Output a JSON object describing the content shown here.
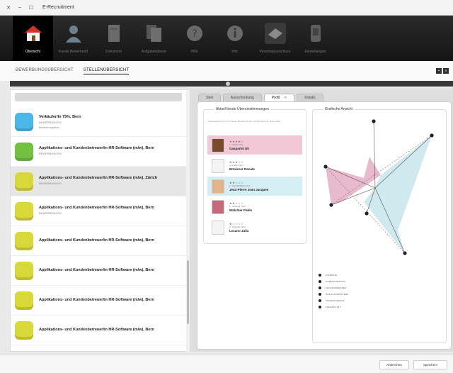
{
  "window": {
    "title": "E-Recruitment",
    "controls": [
      "✕",
      "–",
      "☐"
    ]
  },
  "toolbar": {
    "items": [
      {
        "label": "Übersicht",
        "icon": "house-icon",
        "active": true
      },
      {
        "label": "Kunde Bewerberid",
        "icon": "person-icon",
        "active": false
      },
      {
        "label": "Dokument",
        "icon": "document-icon",
        "active": false
      },
      {
        "label": "Aufgabenplaner",
        "icon": "documents-icon",
        "active": false
      },
      {
        "label": "Hilfe",
        "icon": "help-icon",
        "active": false
      },
      {
        "label": "Info",
        "icon": "info-icon",
        "active": false
      },
      {
        "label": "Personalausschuss",
        "icon": "group-icon",
        "active": false
      },
      {
        "label": "Einstellungen",
        "icon": "phone-icon",
        "active": false
      }
    ]
  },
  "subnav": {
    "tabs": [
      "BEWERBUNGSÜBERSICHT",
      "STELLENÜBERSICHT"
    ],
    "active_index": 1
  },
  "list": {
    "items": [
      {
        "title": "Verkäufer/In 75%, Bern",
        "sub1": "BEWERBUNGEN",
        "sub2": "Bewerbungsfrist",
        "color": "#4bb6e8"
      },
      {
        "title": "Applikations- und Kundenbetreuer/in HR-Software (m/w), Bern",
        "sub1": "BEWERBUNGEN",
        "sub2": "",
        "color": "#74c043"
      },
      {
        "title": "Applikations- und Kundenbetreuer/in HR-Software (m/w), Zürich",
        "sub1": "BEWERBUNGEN",
        "sub2": "",
        "color": "#d9d83a"
      },
      {
        "title": "Applikations- und Kundenbetreuer/in HR-Software (m/w), Bern",
        "sub1": "BEWERBUNGEN",
        "sub2": "",
        "color": "#d9d83a"
      },
      {
        "title": "Applikations- und Kundenbetreuer/in HR-Software (m/w), Bern",
        "sub1": "",
        "sub2": "",
        "color": "#d9d83a"
      },
      {
        "title": "Applikations- und Kundenbetreuer/in HR-Software (m/w), Bern",
        "sub1": "",
        "sub2": "",
        "color": "#d9d83a"
      },
      {
        "title": "Applikations- und Kundenbetreuer/in HR-Software (m/w), Bern",
        "sub1": "",
        "sub2": "",
        "color": "#d9d83a"
      },
      {
        "title": "Applikations- und Kundenbetreuer/in HR-Software (m/w), Bern",
        "sub1": "",
        "sub2": "",
        "color": "#d9d83a"
      }
    ],
    "selected_index": 2
  },
  "detail_tabs": [
    {
      "label": "Stell"
    },
    {
      "label": "Ausschreibung"
    },
    {
      "label": "Profil",
      "active": true,
      "closable": true
    },
    {
      "label": "Details"
    }
  ],
  "current": {
    "title": "Aktuell beste Übereinstimmungen",
    "description": "Dargestellt sind die fünf besten Bewerberinnen und Bewerber für diese Stelle",
    "candidates": [
      {
        "stars": "★★★★☆",
        "date": "1. MÄRZ 2016",
        "name": "Gasparini Uli",
        "bg": "#f2c8d6",
        "photo": "#7a4a2e"
      },
      {
        "stars": "★★★☆☆",
        "date": "3. MÄRZ 2016",
        "name": "Brückner Renate",
        "bg": "#ffffff",
        "photo": "#f4f4f4"
      },
      {
        "stars": "★★☆☆☆",
        "date": "2. SEPTEMBER 2015",
        "name": "Jean-Pierre Jean Jacques",
        "bg": "#d5eef3",
        "photo": "#e2b48a"
      },
      {
        "stars": "★★☆☆☆",
        "date": "5. JANUAR 2016",
        "name": "Wälchler Pablo",
        "bg": "#ffffff",
        "photo": "#c46a7a"
      },
      {
        "stars": "★☆☆☆☆",
        "date": "2. JANUAR 2016",
        "name": "Lozano Julia",
        "bg": "#ffffff",
        "photo": "#f4f4f4"
      }
    ]
  },
  "radar": {
    "title": "Grafische Ansicht",
    "pink": "#e4a8bf",
    "blue": "#bfe2ea",
    "legend": [
      "FÜHRUNG",
      "KOMMUNIKATION",
      "FACHKOMPETENZ",
      "SOZIALKOMPETENZ",
      "TEAMFÄHIGKEIT",
      "FLEXIBILITÄT"
    ]
  },
  "footer": {
    "secondary_label": "Abbrechen",
    "primary_label": "Speichern"
  }
}
